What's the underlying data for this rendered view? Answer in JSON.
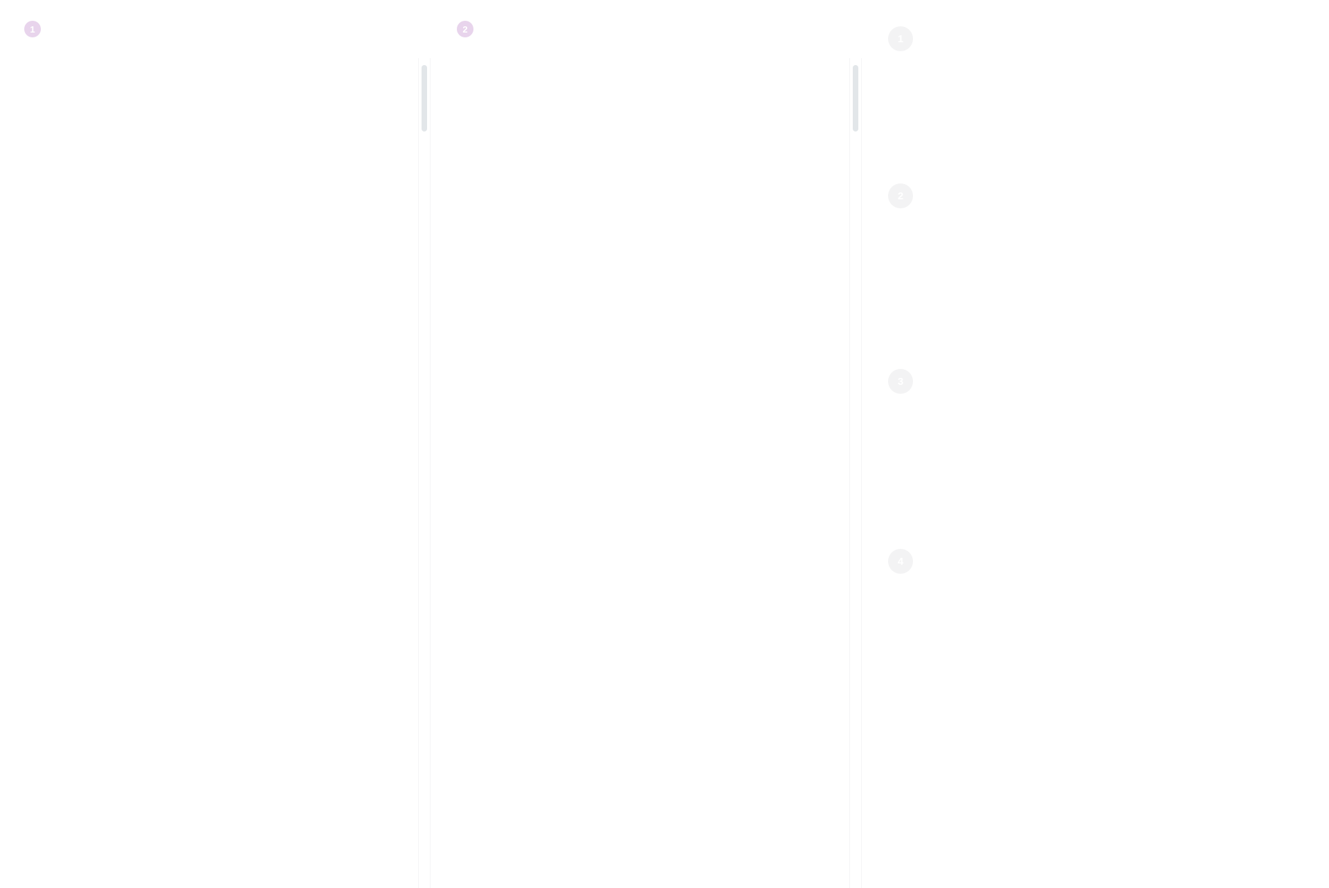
{
  "panels": [
    {
      "step_label": "1",
      "badge_color": "#e8d4ec"
    },
    {
      "step_label": "2",
      "badge_color": "#e8d4ec"
    }
  ],
  "steps": [
    {
      "label": "1"
    },
    {
      "label": "2"
    },
    {
      "label": "3"
    },
    {
      "label": "4"
    }
  ],
  "colors": {
    "badge_pink": "#e8d4ec",
    "badge_grey": "#f3f3f4",
    "scrollbar_thumb": "#e2e6e9",
    "divider": "#f4f5f6"
  }
}
